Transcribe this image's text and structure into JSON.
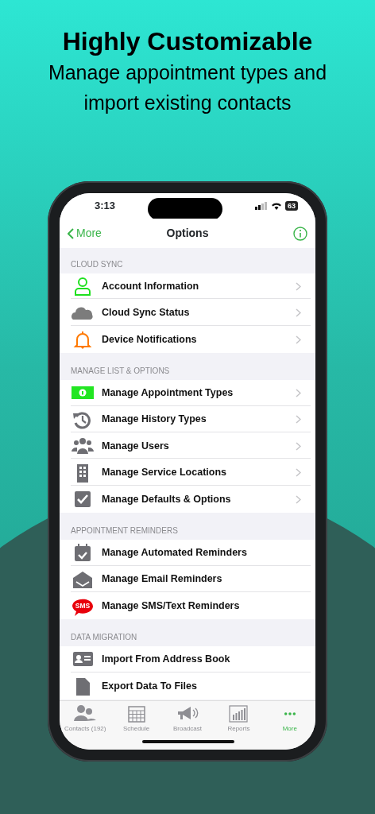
{
  "headline": {
    "title": "Highly Customizable",
    "subtitle": "Manage appointment types and import existing contacts"
  },
  "status_bar": {
    "time": "3:13",
    "battery": "63"
  },
  "nav": {
    "back": "More",
    "title": "Options"
  },
  "sections": [
    {
      "title": "CLOUD SYNC",
      "rows": [
        {
          "label": "Account Information",
          "chevron": true
        },
        {
          "label": "Cloud Sync Status",
          "chevron": true
        },
        {
          "label": "Device Notifications",
          "chevron": true
        }
      ]
    },
    {
      "title": "MANAGE LIST & OPTIONS",
      "rows": [
        {
          "label": "Manage Appointment Types",
          "chevron": true
        },
        {
          "label": "Manage History Types",
          "chevron": true
        },
        {
          "label": "Manage Users",
          "chevron": true
        },
        {
          "label": "Manage Service Locations",
          "chevron": true
        },
        {
          "label": "Manage Defaults & Options",
          "chevron": true
        }
      ]
    },
    {
      "title": "APPOINTMENT REMINDERS",
      "rows": [
        {
          "label": "Manage Automated Reminders",
          "chevron": false
        },
        {
          "label": "Manage Email Reminders",
          "chevron": false
        },
        {
          "icon_text": "SMS",
          "label": "Manage SMS/Text Reminders",
          "chevron": false
        }
      ]
    },
    {
      "title": "DATA MIGRATION",
      "rows": [
        {
          "label": "Import From Address Book",
          "chevron": false
        },
        {
          "label": "Export Data To Files",
          "chevron": false
        }
      ]
    }
  ],
  "tabs": [
    {
      "label": "Contacts (192)",
      "selected": false
    },
    {
      "label": "Schedule",
      "selected": false
    },
    {
      "label": "Broadcast",
      "selected": false
    },
    {
      "label": "Reports",
      "selected": false
    },
    {
      "label": "More",
      "selected": true
    }
  ]
}
